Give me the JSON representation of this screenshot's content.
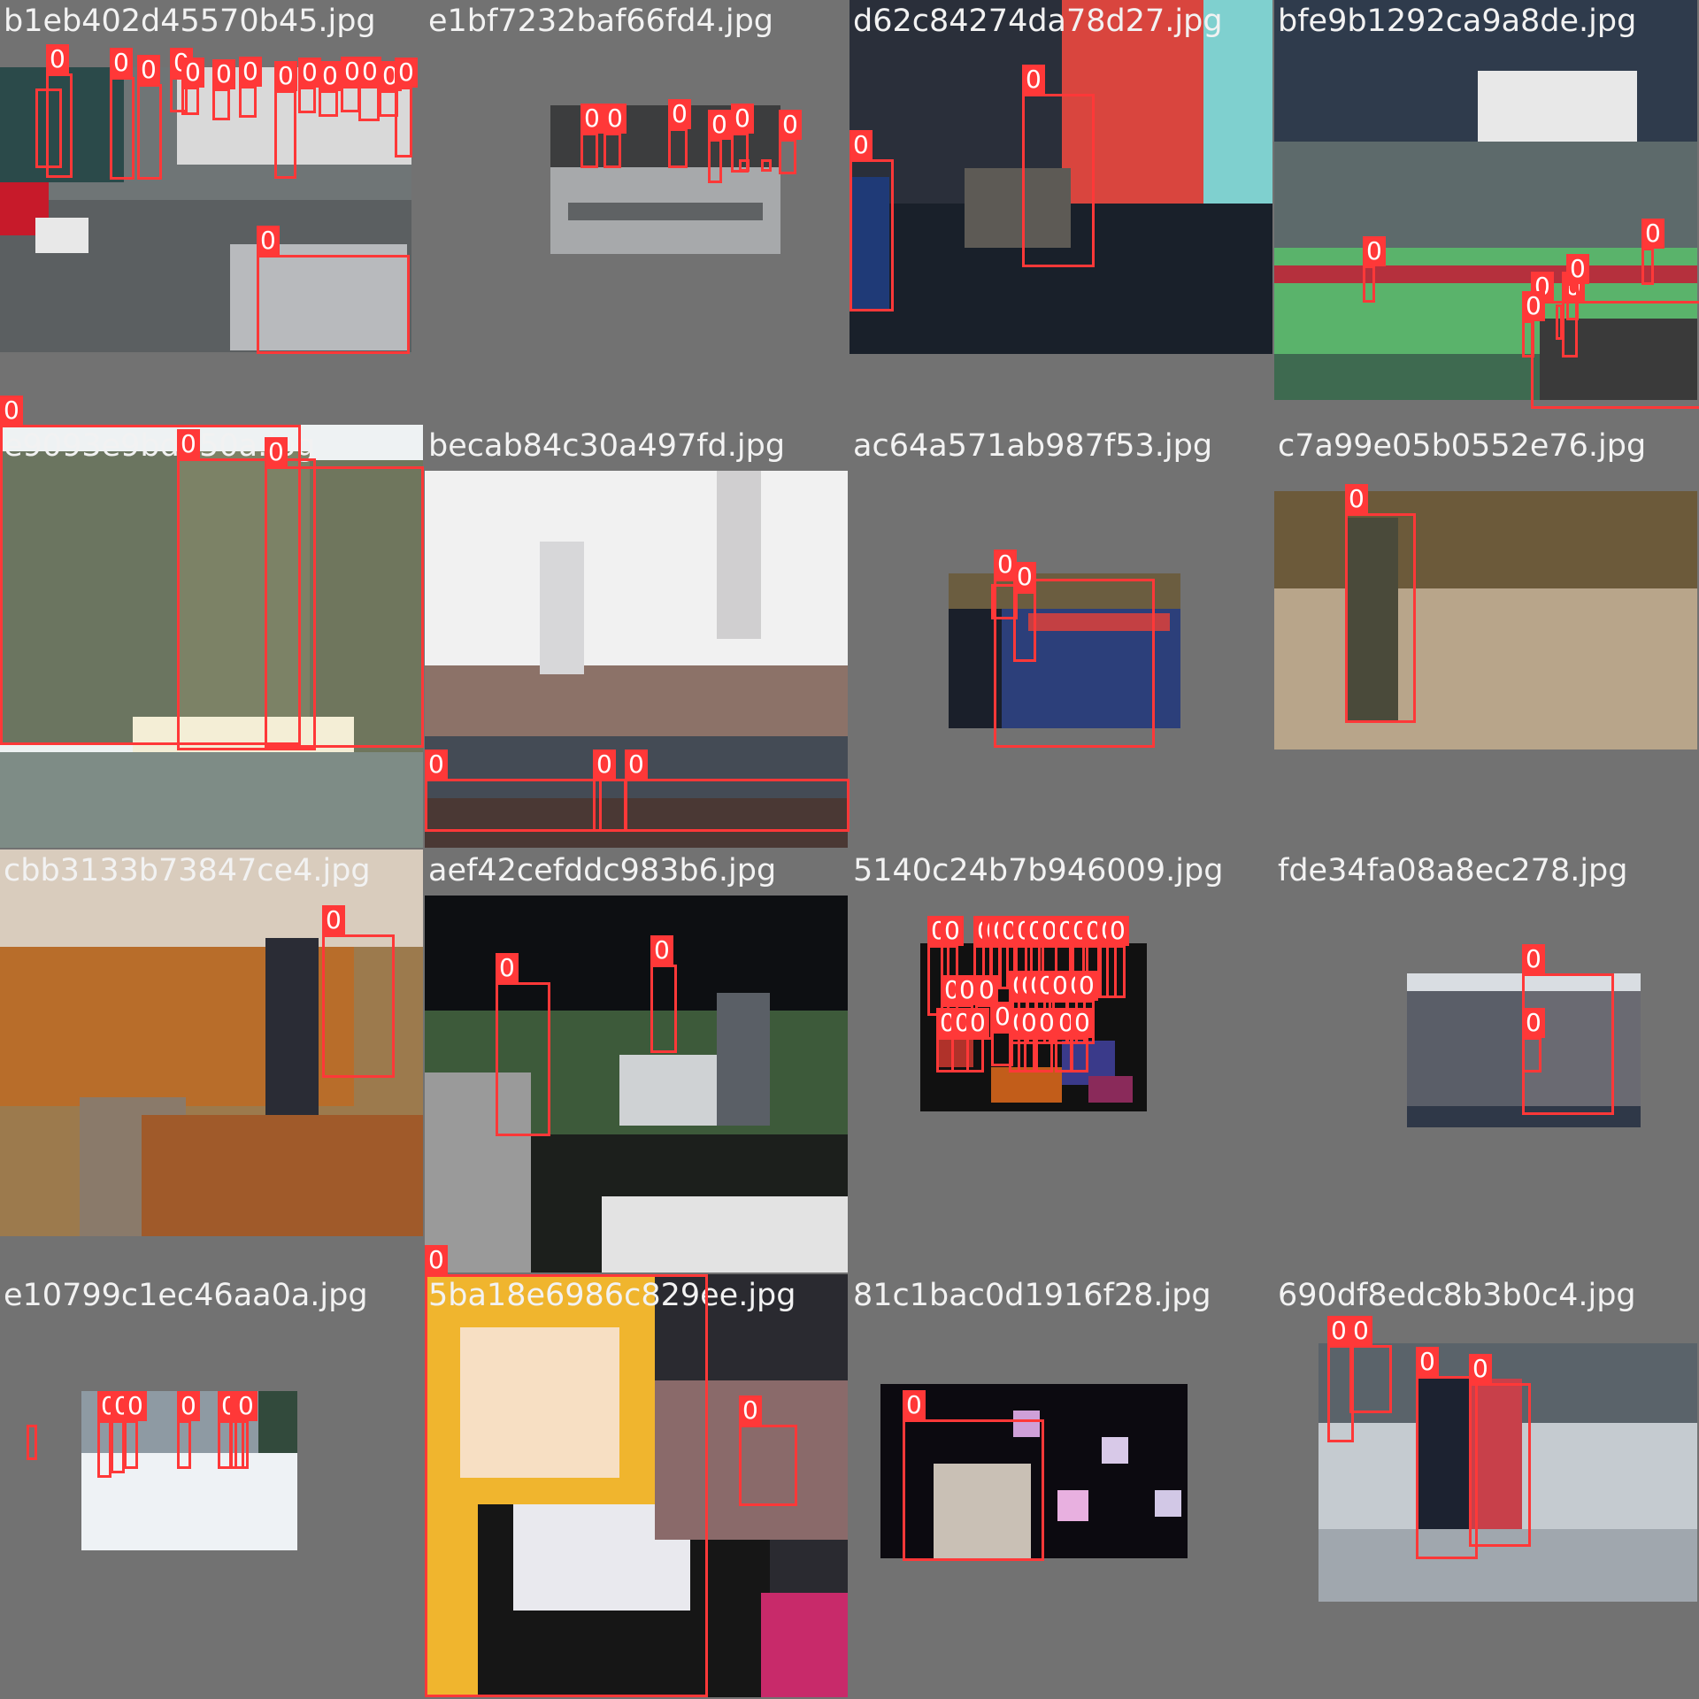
{
  "tiles": [
    {
      "filename": "b1eb402d45570b45.jpg",
      "box_label": "0"
    },
    {
      "filename": "e1bf7232baf66fd4.jpg",
      "box_label": "0"
    },
    {
      "filename": "d62c84274da78d27.jpg",
      "box_label": "0"
    },
    {
      "filename": "bfe9b1292ca9a8de.jpg",
      "box_label": "0"
    },
    {
      "filename": "e9093e9bd550a.jpg",
      "box_label": "0"
    },
    {
      "filename": "becab84c30a497fd.jpg",
      "box_label": "0"
    },
    {
      "filename": "ac64a571ab987f53.jpg",
      "box_label": "0"
    },
    {
      "filename": "c7a99e05b0552e76.jpg",
      "box_label": "0"
    },
    {
      "filename": "cbb3133b73847ce4.jpg",
      "box_label": "0"
    },
    {
      "filename": "aef42cefddc983b6.jpg",
      "box_label": "0"
    },
    {
      "filename": "5140c24b7b946009.jpg",
      "box_label": "0"
    },
    {
      "filename": "fde34fa08a8ec278.jpg",
      "box_label": "0"
    },
    {
      "filename": "e10799c1ec46aa0a.jpg",
      "box_label": "0"
    },
    {
      "filename": "5ba18e6986c829ee.jpg",
      "box_label": "0"
    },
    {
      "filename": "81c1bac0d1916f28.jpg",
      "box_label": "0"
    },
    {
      "filename": "690df8edc8b3b0c4.jpg",
      "box_label": "0"
    }
  ],
  "colors": {
    "box": "#ff3838",
    "label_text": "#ffffff",
    "canvas": "#727272"
  }
}
